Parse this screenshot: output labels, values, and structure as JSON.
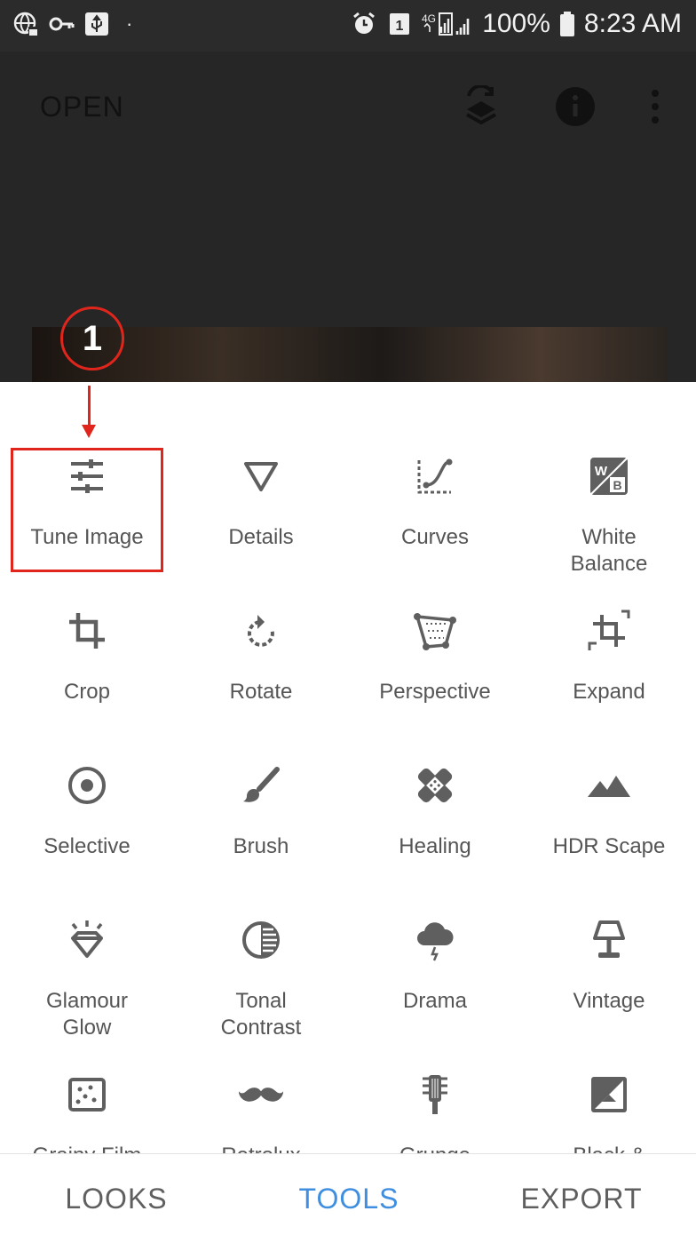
{
  "status_bar": {
    "battery": "100%",
    "time": "8:23 AM"
  },
  "app_bar": {
    "open_label": "OPEN"
  },
  "annotation": {
    "step_number": "1"
  },
  "tools": [
    {
      "label": "Tune Image",
      "icon": "tune-icon"
    },
    {
      "label": "Details",
      "icon": "details-triangle-icon"
    },
    {
      "label": "Curves",
      "icon": "curves-icon"
    },
    {
      "label": "White\nBalance",
      "icon": "white-balance-icon"
    },
    {
      "label": "Crop",
      "icon": "crop-icon"
    },
    {
      "label": "Rotate",
      "icon": "rotate-icon"
    },
    {
      "label": "Perspective",
      "icon": "perspective-icon"
    },
    {
      "label": "Expand",
      "icon": "expand-icon"
    },
    {
      "label": "Selective",
      "icon": "selective-icon"
    },
    {
      "label": "Brush",
      "icon": "brush-icon"
    },
    {
      "label": "Healing",
      "icon": "healing-icon"
    },
    {
      "label": "HDR Scape",
      "icon": "mountain-icon"
    },
    {
      "label": "Glamour\nGlow",
      "icon": "glamour-glow-icon"
    },
    {
      "label": "Tonal\nContrast",
      "icon": "tonal-contrast-icon"
    },
    {
      "label": "Drama",
      "icon": "drama-cloud-icon"
    },
    {
      "label": "Vintage",
      "icon": "vintage-lamp-icon"
    },
    {
      "label": "Grainy Film",
      "icon": "grainy-film-icon"
    },
    {
      "label": "Retrolux",
      "icon": "mustache-icon"
    },
    {
      "label": "Grunge",
      "icon": "grunge-guitar-icon"
    },
    {
      "label": "Black &",
      "icon": "black-white-icon"
    }
  ],
  "bottom_nav": {
    "looks": "LOOKS",
    "tools": "TOOLS",
    "export": "EXPORT"
  },
  "colors": {
    "accent": "#3f8ee0",
    "annotation": "#e0261c",
    "icon": "#5f5f5f",
    "label": "#555555"
  }
}
